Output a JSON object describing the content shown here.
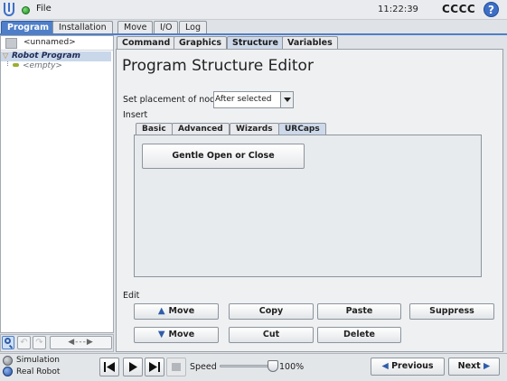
{
  "header": {
    "file_menu": "File",
    "clock": "11:22:39",
    "robot_name": "CCCC",
    "help": "?"
  },
  "top_tabs": [
    {
      "label": "Program",
      "active": true
    },
    {
      "label": "Installation",
      "active": false
    },
    {
      "label": "Move",
      "active": false
    },
    {
      "label": "I/O",
      "active": false
    },
    {
      "label": "Log",
      "active": false
    }
  ],
  "program_tree": {
    "file_name": "<unnamed>",
    "root": "Robot Program",
    "child": "<empty>"
  },
  "left_toolbar": {
    "undo_icon": "↶",
    "redo_icon": "↷",
    "move_arrows": "◀---▶"
  },
  "sub_tabs": [
    {
      "label": "Command",
      "active": false
    },
    {
      "label": "Graphics",
      "active": false
    },
    {
      "label": "Structure",
      "active": true
    },
    {
      "label": "Variables",
      "active": false
    }
  ],
  "editor": {
    "title": "Program Structure Editor",
    "placement_label": "Set placement of node",
    "placement_value": "After selected",
    "insert_label": "Insert",
    "insert_tabs": [
      {
        "label": "Basic",
        "active": false
      },
      {
        "label": "Advanced",
        "active": false
      },
      {
        "label": "Wizards",
        "active": false
      },
      {
        "label": "URCaps",
        "active": true
      }
    ],
    "urcap_button": "Gentle Open or Close",
    "edit_label": "Edit",
    "edit_buttons": {
      "move_up": "Move",
      "move_down": "Move",
      "copy": "Copy",
      "cut": "Cut",
      "paste": "Paste",
      "delete": "Delete",
      "suppress": "Suppress"
    }
  },
  "footer": {
    "simulation": "Simulation",
    "real_robot": "Real Robot",
    "speed_label": "Speed",
    "speed_value": "100%",
    "speed_fraction": 1.0,
    "previous": "Previous",
    "next": "Next"
  },
  "colors": {
    "accent": "#4f7fc8",
    "status_ok": "#2aa12a"
  }
}
